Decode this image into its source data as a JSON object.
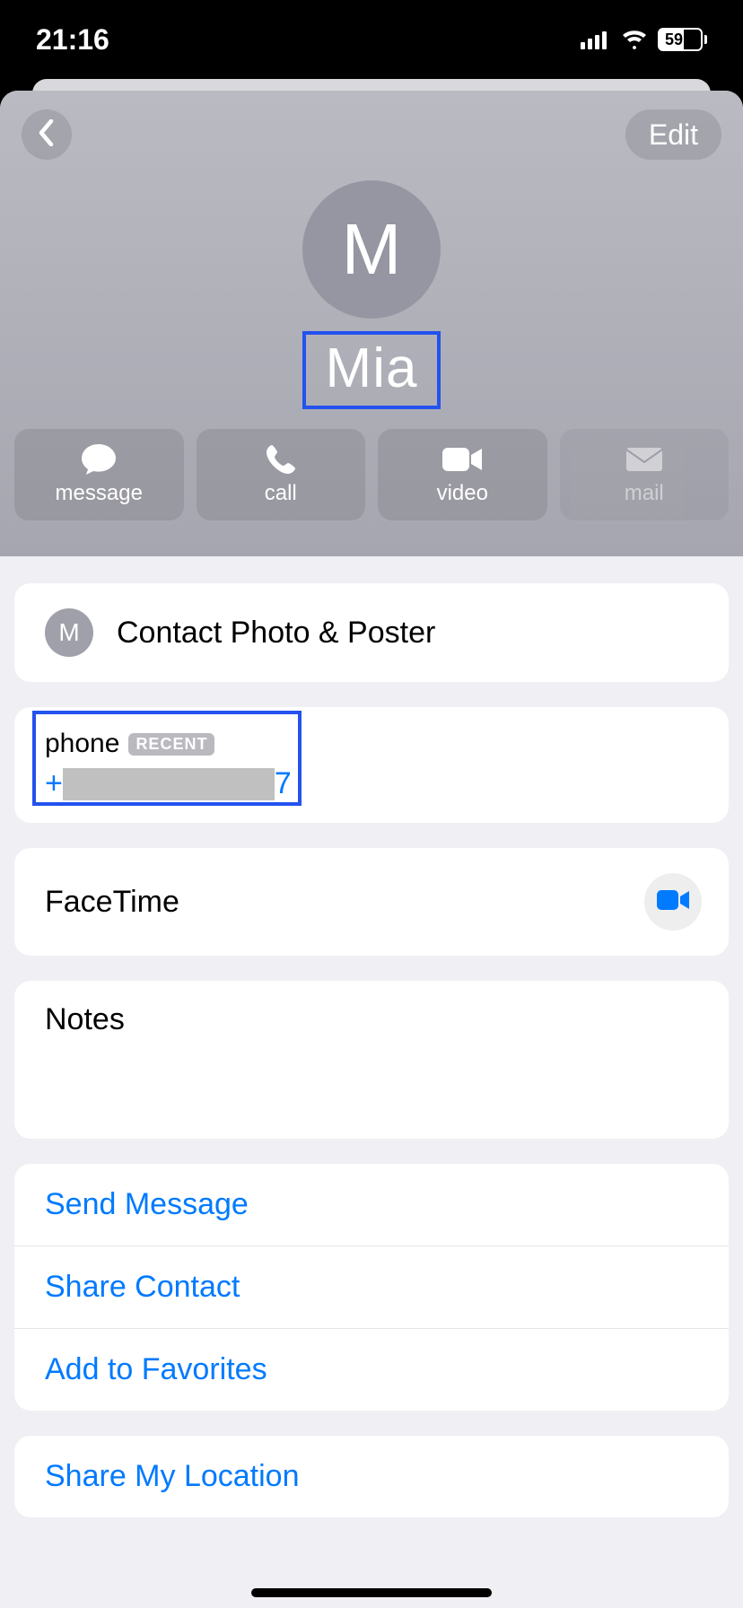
{
  "status": {
    "time": "21:16",
    "battery": "59"
  },
  "header": {
    "edit_label": "Edit",
    "avatar_initial": "M",
    "contact_name": "Mia"
  },
  "actions": {
    "message": "message",
    "call": "call",
    "video": "video",
    "mail": "mail"
  },
  "rows": {
    "photo_poster": "Contact Photo & Poster",
    "avatar_initial_small": "M",
    "phone_label": "phone",
    "recent_badge": "RECENT",
    "phone_prefix": "+",
    "phone_suffix": "7",
    "facetime": "FaceTime",
    "notes": "Notes"
  },
  "links": {
    "send_message": "Send Message",
    "share_contact": "Share Contact",
    "add_favorites": "Add to Favorites",
    "share_location": "Share My Location"
  }
}
